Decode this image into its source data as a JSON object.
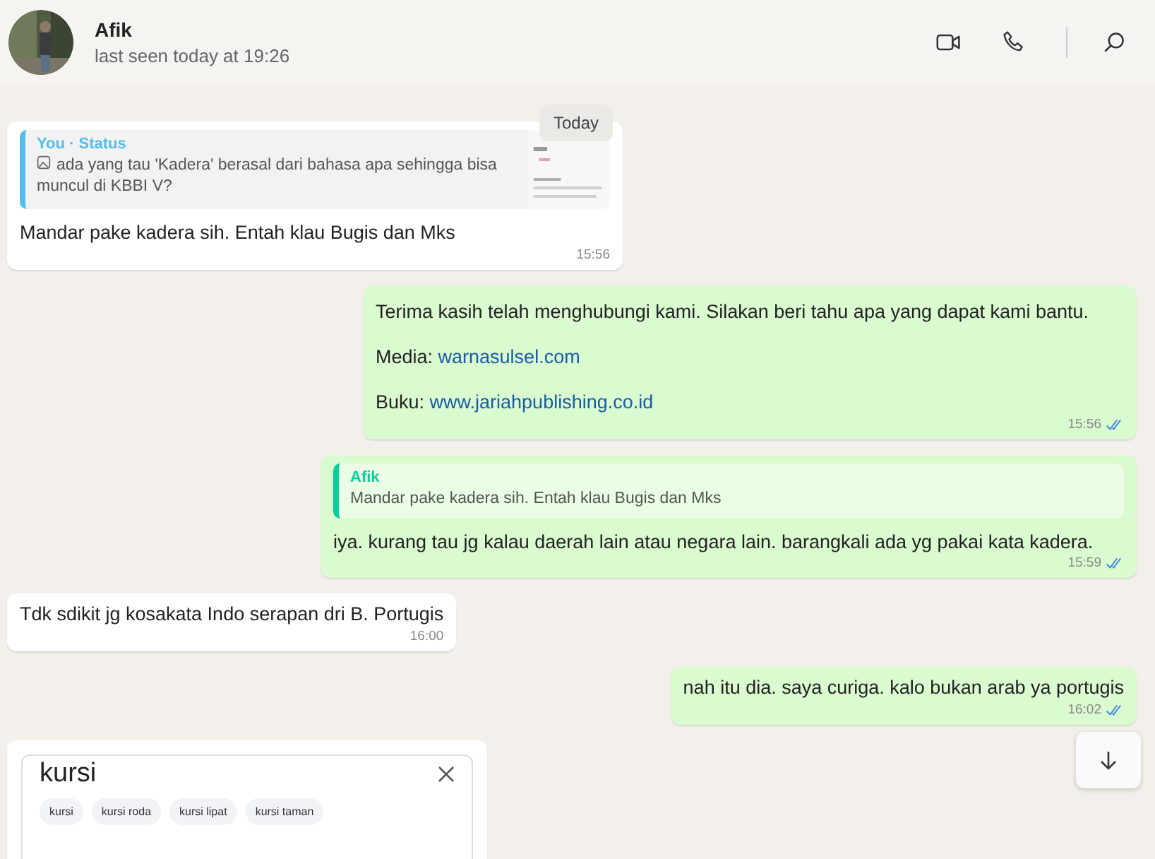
{
  "header": {
    "name": "Afik",
    "status": "last seen today at 19:26"
  },
  "date_chip": "Today",
  "messages": [
    {
      "kind": "incoming",
      "quote": {
        "author": "You · Status",
        "text": "ada yang tau 'Kadera' berasal dari bahasa apa sehingga bisa muncul di KBBI V?",
        "has_image": true
      },
      "paragraphs": [
        {
          "text": "Mandar pake kadera sih. Entah klau Bugis dan Mks"
        }
      ],
      "time": "15:56"
    },
    {
      "kind": "outgoing",
      "read": true,
      "paragraphs": [
        {
          "text": "Terima kasih telah menghubungi kami. Silakan beri tahu apa yang dapat kami bantu."
        },
        {
          "text": "Media: ",
          "link": "warnasulsel.com"
        },
        {
          "text": "Buku: ",
          "link": "www.jariahpublishing.co.id"
        }
      ],
      "time": "15:56"
    },
    {
      "kind": "outgoing",
      "read": true,
      "quote": {
        "author": "Afik",
        "text": "Mandar pake kadera sih. Entah klau Bugis dan Mks",
        "has_image": false
      },
      "paragraphs": [
        {
          "text": "iya. kurang tau jg kalau daerah lain atau negara lain. barangkali ada yg pakai kata kadera."
        }
      ],
      "time": "15:59"
    },
    {
      "kind": "incoming",
      "paragraphs": [
        {
          "text": "Tdk sdikit jg kosakata Indo serapan dri B. Portugis"
        }
      ],
      "time": "16:00"
    },
    {
      "kind": "outgoing",
      "read": true,
      "paragraphs": [
        {
          "text": "nah itu dia. saya curiga. kalo bukan arab ya portugis"
        }
      ],
      "time": "16:02"
    },
    {
      "kind": "screenshot",
      "query": "kursi",
      "chips": [
        "kursi",
        "kursi roda",
        "kursi lipat",
        "kursi taman"
      ]
    }
  ]
}
